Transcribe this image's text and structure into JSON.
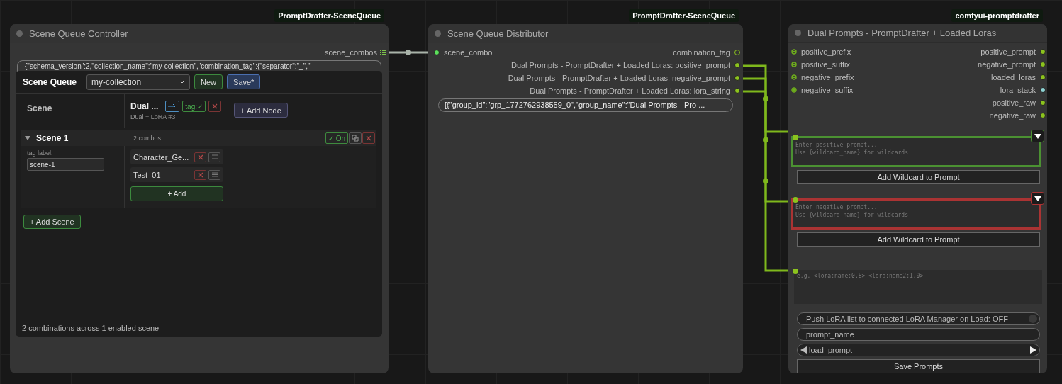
{
  "controller": {
    "group_label": "PromptDrafter-SceneQueue",
    "title": "Scene Queue Controller",
    "outputs": [
      {
        "name": "scene_combos"
      }
    ],
    "json_preview": "{\"schema_version\":2,\"collection_name\":\"my-collection\",\"combination_tag\":{\"separator\":\"_\",\"",
    "scene_queue": {
      "title": "Scene Queue",
      "collection": "my-collection",
      "buttons": [
        {
          "label": "New",
          "kind": "new"
        },
        {
          "label": "Save*",
          "kind": "save"
        }
      ],
      "scene_column": "Scene",
      "node_column": {
        "name": "Dual ...",
        "subtitle": "Dual + LoRA #3",
        "tag_toggle": "tag:✓"
      },
      "add_node": "+ Add Node",
      "scenes": [
        {
          "name": "Scene 1",
          "combos_count": "2 combos",
          "expanded": true,
          "enabled": true,
          "toggle_label": "✓ On",
          "tag_caption": "tag label:",
          "tag_value": "scene-1",
          "combos": [
            {
              "name": "Character_Ge..."
            },
            {
              "name": "Test_01"
            }
          ],
          "add_label": "+ Add"
        }
      ],
      "add_scene": "+ Add Scene",
      "footer": "2 combinations across 1 enabled scene"
    }
  },
  "distributor": {
    "group_label": "PromptDrafter-SceneQueue",
    "title": "Scene Queue Distributor",
    "inputs": [
      {
        "name": "scene_combo",
        "connected": true
      }
    ],
    "outputs": [
      {
        "name": "combination_tag",
        "connected": false
      },
      {
        "name": "Dual Prompts - PromptDrafter + Loaded Loras: positive_prompt",
        "connected": true
      },
      {
        "name": "Dual Prompts - PromptDrafter + Loaded Loras: negative_prompt",
        "connected": true
      },
      {
        "name": "Dual Prompts - PromptDrafter + Loaded Loras: lora_string",
        "connected": true
      }
    ],
    "value": "[{\"group_id\":\"grp_1772762938559_0\",\"group_name\":\"Dual Prompts - Pro  ..."
  },
  "dual_prompts": {
    "group_label": "comfyui-promptdrafter",
    "title": "Dual Prompts - PromptDrafter + Loaded Loras",
    "inputs": [
      {
        "name": "positive_prefix"
      },
      {
        "name": "positive_suffix"
      },
      {
        "name": "negative_prefix"
      },
      {
        "name": "negative_suffix"
      }
    ],
    "outputs": [
      {
        "name": "positive_prompt",
        "color": "#8cc31e"
      },
      {
        "name": "negative_prompt",
        "color": "#8cc31e"
      },
      {
        "name": "loaded_loras",
        "color": "#8cc31e"
      },
      {
        "name": "lora_stack",
        "color": "#8ed3d3"
      },
      {
        "name": "positive_raw",
        "color": "#8cc31e"
      },
      {
        "name": "negative_raw",
        "color": "#8cc31e"
      }
    ],
    "prompts": [
      {
        "kind": "positive",
        "placeholder": "Enter positive prompt...\nUse {wildcard_name} for wildcards",
        "button": "Add Wildcard to Prompt"
      },
      {
        "kind": "negative",
        "placeholder": "Enter negative prompt...\nUse {wildcard_name} for wildcards",
        "button": "Add Wildcard to Prompt"
      }
    ],
    "lora_placeholder": "e.g. <lora:name:0.8> <lora:name2:1.0>",
    "toggle": {
      "label": "Push LoRA list to connected LoRA Manager on Load: OFF",
      "on": false
    },
    "prompt_name": "prompt_name",
    "load_prompt": "load_prompt",
    "save_button": "Save Prompts"
  }
}
